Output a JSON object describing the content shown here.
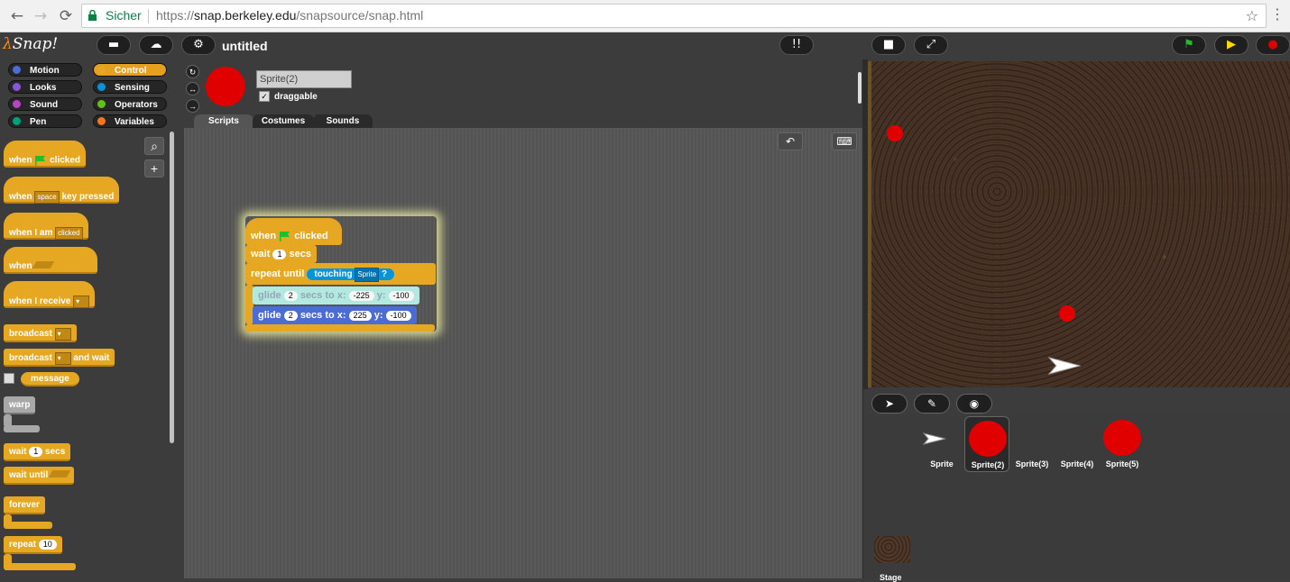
{
  "browser": {
    "back": "←",
    "forward": "→",
    "reload": "⟳",
    "secure_label": "Sicher",
    "url_prefix": "https://",
    "url_host": "snap.berkeley.edu",
    "url_path": "/snapsource/snap.html",
    "star": "☆",
    "menu": "⋮"
  },
  "topbar": {
    "logo_lambda": "λ",
    "logo_text": "Snap!",
    "file_icon": "▬",
    "cloud_icon": "☁",
    "settings_icon": "⚙",
    "project_title": "untitled",
    "dev_icon": "!!",
    "stage_size_icon": "■",
    "fullscreen_icon": "⤢",
    "green_flag": "⚑",
    "pause": "▶",
    "stop": "●"
  },
  "categories": [
    {
      "label": "Motion",
      "color": "#4a6cd4"
    },
    {
      "label": "Control",
      "color": "#e6a822"
    },
    {
      "label": "Looks",
      "color": "#8a55d7"
    },
    {
      "label": "Sensing",
      "color": "#0494dc"
    },
    {
      "label": "Sound",
      "color": "#bb42c3"
    },
    {
      "label": "Operators",
      "color": "#62c213"
    },
    {
      "label": "Pen",
      "color": "#00a178"
    },
    {
      "label": "Variables",
      "color": "#f3761d"
    }
  ],
  "palette": {
    "when_flag": {
      "when": "when",
      "clicked": "clicked"
    },
    "when_key": {
      "when": "when",
      "key": "space",
      "rest": "key pressed"
    },
    "when_i_am": {
      "when": "when I am",
      "opt": "clicked"
    },
    "when_cond": {
      "when": "when"
    },
    "when_receive": {
      "label": "when I receive"
    },
    "broadcast": {
      "label": "broadcast"
    },
    "broadcast_wait": {
      "label": "broadcast",
      "rest": "and wait"
    },
    "message": {
      "label": "message"
    },
    "warp": {
      "label": "warp"
    },
    "wait": {
      "label": "wait",
      "value": "1",
      "unit": "secs"
    },
    "wait_until": {
      "label": "wait until"
    },
    "forever": {
      "label": "forever"
    },
    "repeat": {
      "label": "repeat",
      "value": "10"
    }
  },
  "sprite": {
    "name": "Sprite(2)",
    "draggable_label": "draggable",
    "check": "✓",
    "rot1": "↻",
    "rot2": "↔",
    "rot3": "→"
  },
  "tabs": [
    "Scripts",
    "Costumes",
    "Sounds"
  ],
  "editor": {
    "undo_icon": "↶",
    "keyboard_icon": "⌨"
  },
  "script": {
    "hat": {
      "when": "when",
      "clicked": "clicked"
    },
    "wait": {
      "label": "wait",
      "value": "1",
      "unit": "secs"
    },
    "repeat": {
      "label": "repeat until",
      "cond": "touching",
      "target": "Sprite",
      "q": "?"
    },
    "glide1": {
      "label": "glide",
      "secs": "2",
      "mid": "secs to x:",
      "x": "-225",
      "ylabel": "y:",
      "y": "-100"
    },
    "glide2": {
      "label": "glide",
      "secs": "2",
      "mid": "secs to x:",
      "x": "225",
      "ylabel": "y:",
      "y": "-100"
    }
  },
  "corral_bar": {
    "turtle_icon": "➤",
    "paint_icon": "✎",
    "camera_icon": "◉"
  },
  "corral": {
    "sprites": [
      "Sprite",
      "Sprite(2)",
      "Sprite(3)",
      "Sprite(4)",
      "Sprite(5)"
    ],
    "stage_label": "Stage"
  }
}
